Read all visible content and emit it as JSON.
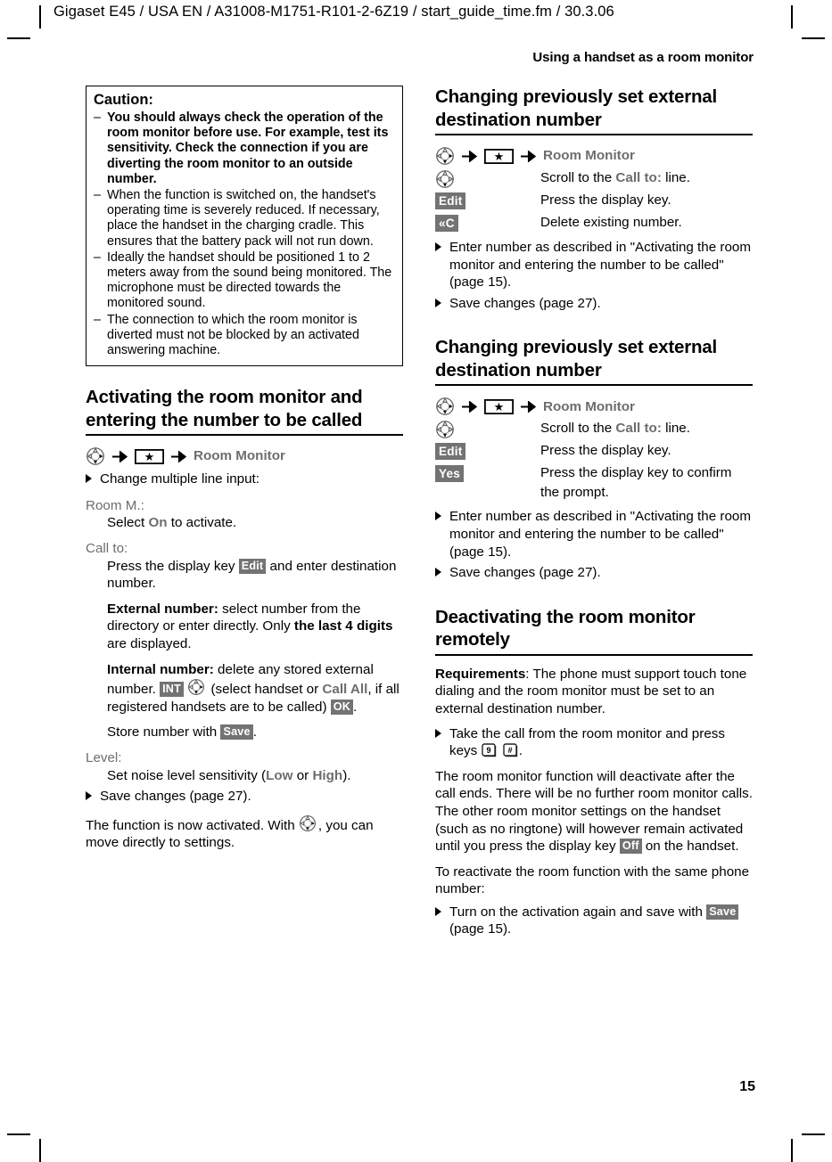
{
  "header": {
    "file_line": "Gigaset E45 / USA EN / A31008-M1751-R101-2-6Z19  / start_guide_time.fm / 30.3.06",
    "running_head": "Using a handset as a room monitor"
  },
  "page_number": "15",
  "caution": {
    "title": "Caution:",
    "items": [
      {
        "bold": true,
        "marker": "–",
        "text": "You should always check the operation of the room monitor before use. For example, test its sensitivity. Check the connection if you are diverting the room monitor to an outside number."
      },
      {
        "bold": false,
        "marker": "–",
        "text": "When the function is switched on, the handset's operating time is severely reduced. If necessary, place the handset in the charging cradle. This ensures that the battery pack will not run down."
      },
      {
        "bold": false,
        "marker": "–",
        "text": "Ideally the handset should be positioned 1 to 2 meters away from the sound being monitored. The microphone must be directed towards the monitored sound."
      },
      {
        "bold": false,
        "marker": "–",
        "text": "The connection to which the room monitor is diverted must not be blocked by an activated answering machine."
      }
    ]
  },
  "sections": {
    "activating": {
      "heading": "Activating the room monitor and entering the number to be called",
      "menu_path": {
        "nav_icon": "control-pad-icon",
        "arrow": "→",
        "star_key_icon": "star-key-icon",
        "menu_name": "Room Monitor"
      },
      "bullet_change": "Change multiple line input:",
      "room_m_label": "Room M.:",
      "room_m_text_pre": "Select ",
      "room_m_option": "On",
      "room_m_text_post": " to activate.",
      "call_to_label": "Call to:",
      "call_to_line1_pre": "Press the display key ",
      "call_to_chip": "Edit",
      "call_to_line1_post": " and enter destination number.",
      "external_label": "External number:",
      "external_text_a": " select number from the directory or enter directly. Only ",
      "external_bold": "the last 4 digits",
      "external_text_b": " are displayed.",
      "internal_label": "Internal number:",
      "internal_text_a": " delete any stored external number. ",
      "internal_chip": "INT",
      "internal_text_b": " (select handset or ",
      "internal_option": "Call All",
      "internal_text_c": ", if all registered handsets are to be called) ",
      "internal_chip2": "OK",
      "internal_text_d": ".",
      "store_pre": "Store number with ",
      "store_chip": "Save",
      "store_post": ".",
      "level_label": "Level:",
      "level_pre": "Set noise level sensitivity (",
      "level_opt_low": "Low",
      "level_mid": " or ",
      "level_opt_high": "High",
      "level_post": ").",
      "save_bullet": "Save changes (page 27).",
      "closing_pre": "The function is now activated. With ",
      "closing_post": ", you can move directly to settings."
    },
    "changing_external_1": {
      "heading": "Changing previously set external destination number",
      "menu_path": {
        "nav_icon": "control-pad-icon",
        "star_key_icon": "star-key-icon",
        "menu_name": "Room Monitor"
      },
      "steps": [
        {
          "key_type": "nav",
          "key_label": "",
          "desc_pre": "Scroll to the ",
          "desc_opt": "Call to:",
          "desc_post": " line."
        },
        {
          "key_type": "chip",
          "key_label": "Edit",
          "desc_pre": "Press the display key.",
          "desc_opt": "",
          "desc_post": ""
        },
        {
          "key_type": "chip",
          "key_label": "«C",
          "desc_pre": "Delete existing number.",
          "desc_opt": "",
          "desc_post": ""
        }
      ],
      "bullets": [
        "Enter number as described in \"Activating the room monitor and entering the number to be called\" (page 15).",
        "Save changes (page 27)."
      ]
    },
    "changing_external_2": {
      "heading": "Changing previously set external destination number",
      "menu_path": {
        "nav_icon": "control-pad-icon",
        "star_key_icon": "star-key-icon",
        "menu_name": "Room Monitor"
      },
      "steps": [
        {
          "key_type": "nav",
          "key_label": "",
          "desc_pre": "Scroll to the ",
          "desc_opt": "Call to:",
          "desc_post": " line."
        },
        {
          "key_type": "chip",
          "key_label": "Edit",
          "desc_pre": "Press the display key.",
          "desc_opt": "",
          "desc_post": ""
        },
        {
          "key_type": "chip",
          "key_label": "Yes",
          "desc_pre": "Press the display key to confirm the prompt.",
          "desc_opt": "",
          "desc_post": ""
        }
      ],
      "bullets": [
        "Enter number as described in \"Activating the room monitor and entering the number to be called\" (page 15).",
        "Save changes (page 27)."
      ]
    },
    "deactivating": {
      "heading": "Deactivating the room monitor remotely",
      "requirements_label": "Requirements",
      "requirements_text": ": The phone must support touch tone dialing and the room monitor must be set to an external destination number.",
      "bullet_take_call_pre": "Take the call from the room monitor and press keys ",
      "key_9": "9",
      "key_hash": "#",
      "bullet_take_call_post": ".",
      "para_deactivate_a": "The room monitor function will deactivate after the call ends. There will be no further room monitor calls. The other room monitor settings on the handset (such as no ringtone) will however remain activated until you press the display key ",
      "para_deactivate_chip": "Off",
      "para_deactivate_b": " on the handset.",
      "para_reactivate": "To reactivate the room function with the same phone number:",
      "bullet_turn_on_pre": "Turn on the activation again and save with ",
      "bullet_turn_on_chip": "Save",
      "bullet_turn_on_post": " (page 15)."
    }
  },
  "colors": {
    "chip_bg": "#737373",
    "chip_fg": "#ffffff",
    "menu_grey": "#6d6d6d",
    "rule": "#000000"
  }
}
